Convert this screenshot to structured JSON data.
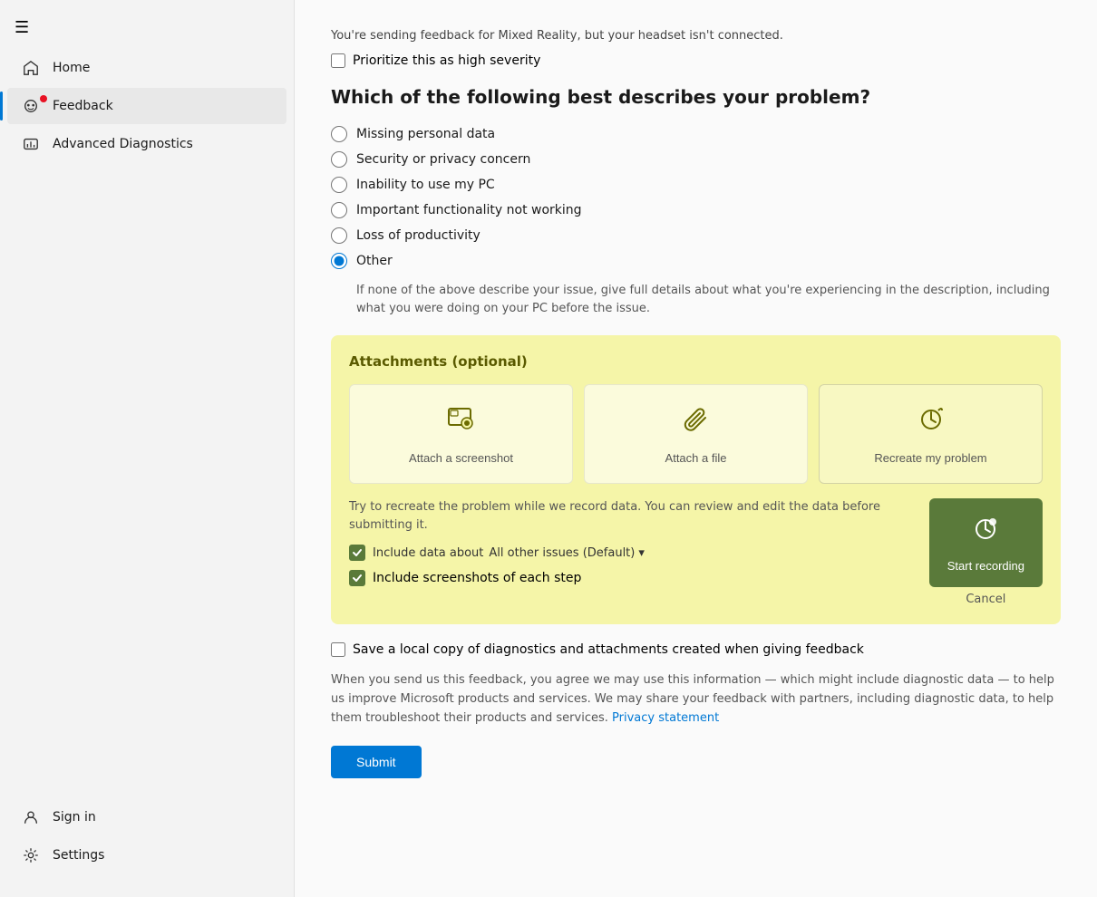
{
  "sidebar": {
    "hamburger_icon": "☰",
    "items": [
      {
        "id": "home",
        "label": "Home",
        "active": false
      },
      {
        "id": "feedback",
        "label": "Feedback",
        "active": true
      },
      {
        "id": "advanced-diagnostics",
        "label": "Advanced Diagnostics",
        "active": false
      }
    ],
    "bottom_items": [
      {
        "id": "sign-in",
        "label": "Sign in"
      },
      {
        "id": "settings",
        "label": "Settings"
      }
    ]
  },
  "main": {
    "notice": "You're sending feedback for Mixed Reality, but your headset isn't connected.",
    "high_severity_label": "Prioritize this as high severity",
    "section_title": "Which of the following best describes your problem?",
    "radio_options": [
      {
        "id": "missing-data",
        "label": "Missing personal data"
      },
      {
        "id": "security",
        "label": "Security or privacy concern"
      },
      {
        "id": "inability",
        "label": "Inability to use my PC"
      },
      {
        "id": "functionality",
        "label": "Important functionality not working"
      },
      {
        "id": "productivity",
        "label": "Loss of productivity"
      },
      {
        "id": "other",
        "label": "Other",
        "selected": true
      }
    ],
    "other_description": "If none of the above describe your issue, give full details about what you're experiencing in the description, including what you were doing on your PC before the issue.",
    "attachments": {
      "title": "Attachments (optional)",
      "buttons": [
        {
          "id": "screenshot",
          "label": "Attach a screenshot"
        },
        {
          "id": "file",
          "label": "Attach a file"
        },
        {
          "id": "recreate",
          "label": "Recreate my problem"
        }
      ],
      "recreate_info": "Try to recreate the problem while we record data. You can review and edit the data before submitting it.",
      "include_data_label": "Include data about",
      "include_data_value": "All other issues (Default)",
      "include_screenshots_label": "Include screenshots of each step",
      "start_recording_label": "Start recording",
      "cancel_label": "Cancel"
    },
    "save_copy_label": "Save a local copy of diagnostics and attachments created when giving feedback",
    "privacy_text": "When you send us this feedback, you agree we may use this information — which might include diagnostic data — to help us improve Microsoft products and services. We may share your feedback with partners, including diagnostic data, to help them troubleshoot their products and services.",
    "privacy_link": "Privacy statement",
    "submit_label": "Submit"
  }
}
